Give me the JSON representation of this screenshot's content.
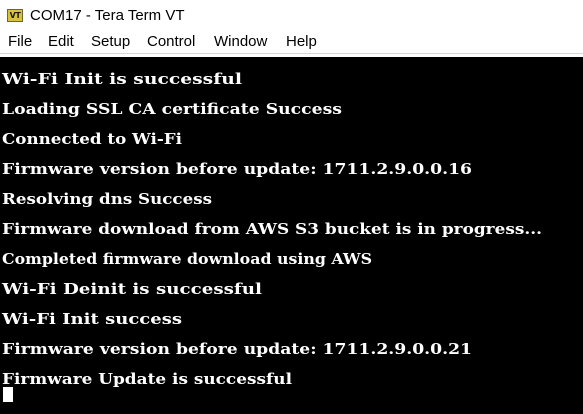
{
  "window": {
    "title": "COM17 - Tera Term VT",
    "icon_label": "VT"
  },
  "menubar": {
    "items": [
      "File",
      "Edit",
      "Setup",
      "Control",
      "Window",
      "Help"
    ]
  },
  "terminal": {
    "lines": [
      "Wi-Fi Init is successful",
      "Loading SSL CA certificate Success",
      "Connected to Wi-Fi",
      "Firmware version before update: 1711.2.9.0.0.16",
      "Resolving dns Success",
      "Firmware download from AWS S3 bucket is in progress...",
      "Completed firmware download using AWS",
      "Wi-Fi Deinit is successful",
      "Wi-Fi Init success",
      "Firmware version before update: 1711.2.9.0.0.21",
      "Firmware Update is successful"
    ],
    "colors": {
      "background": "#000000",
      "foreground": "#ffffff"
    }
  }
}
